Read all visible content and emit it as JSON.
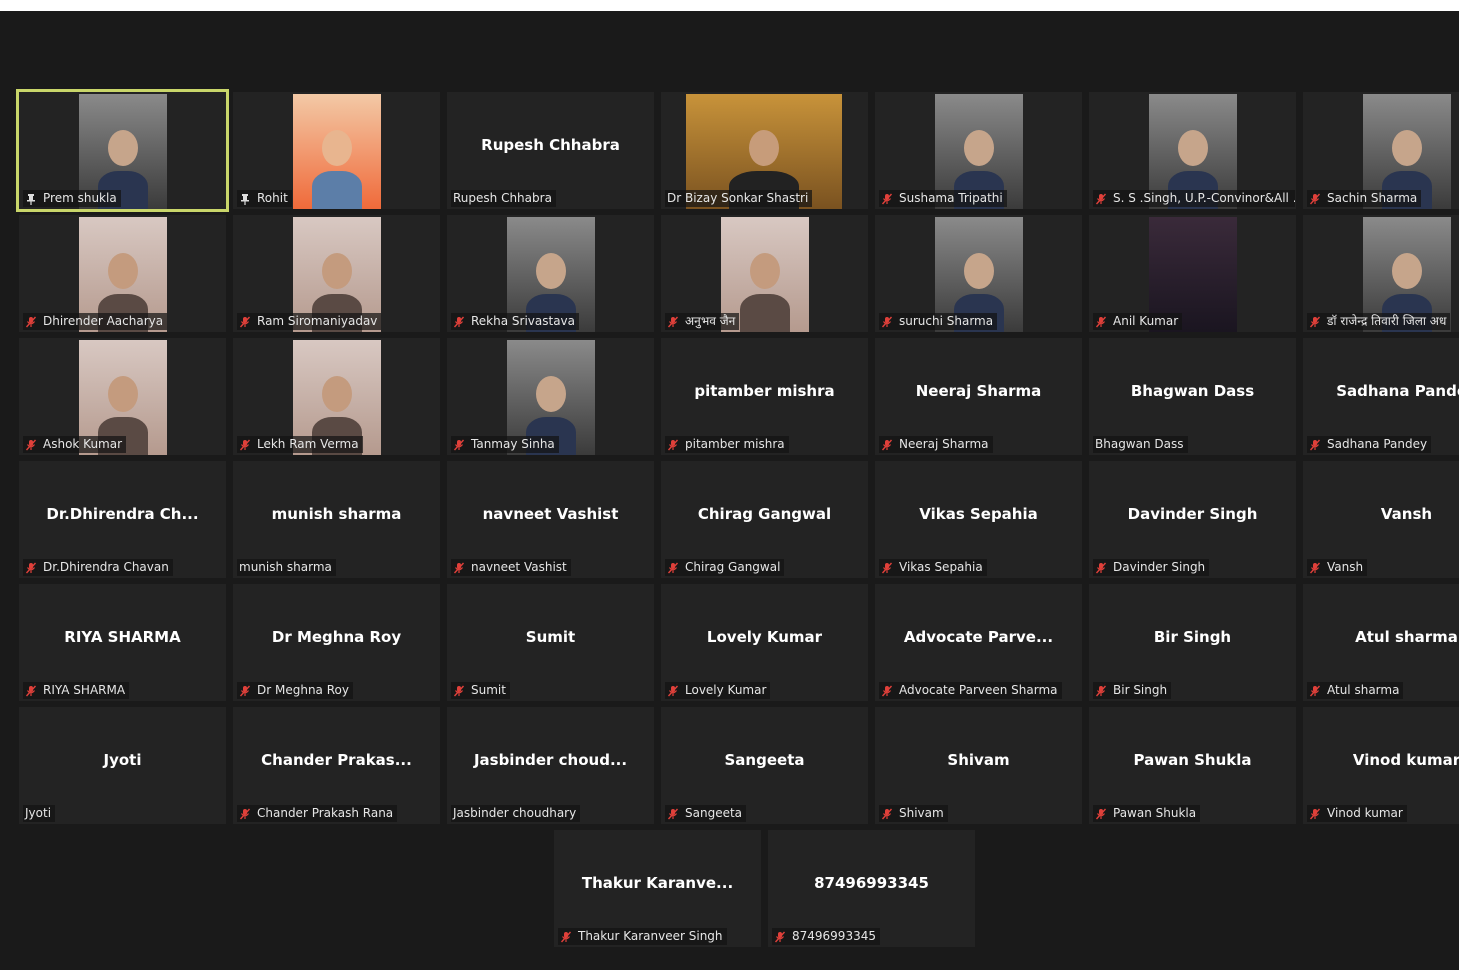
{
  "colors": {
    "background": "#1a1a1a",
    "tile": "#232323",
    "active_border": "#c9d66a",
    "mute": "#e0403a"
  },
  "participants": [
    {
      "name": "Prem shukla",
      "display": "",
      "icon": "pin-icon",
      "video": "person",
      "active": true
    },
    {
      "name": "Rohit",
      "display": "",
      "icon": "pin-icon",
      "video": "poster"
    },
    {
      "name": "Rupesh Chhabra",
      "display": "Rupesh Chhabra",
      "icon": "none",
      "video": "none"
    },
    {
      "name": "Dr Bizay Sonkar Shastri",
      "display": "",
      "icon": "none",
      "video": "wide"
    },
    {
      "name": "Sushama Tripathi",
      "display": "",
      "icon": "mic-muted-icon",
      "video": "person"
    },
    {
      "name": "S. S .Singh, U.P.-Convinor&All ...",
      "display": "",
      "icon": "mic-muted-icon",
      "video": "person"
    },
    {
      "name": "Sachin Sharma",
      "display": "",
      "icon": "mic-muted-icon",
      "video": "person"
    },
    {
      "name": "Dhirender Aacharya",
      "display": "",
      "icon": "mic-muted-icon",
      "video": "room"
    },
    {
      "name": "Ram Siromaniyadav",
      "display": "",
      "icon": "mic-muted-icon",
      "video": "room"
    },
    {
      "name": "Rekha Srivastava",
      "display": "",
      "icon": "mic-muted-icon",
      "video": "person"
    },
    {
      "name": "अनुभव जैन",
      "display": "",
      "icon": "mic-muted-icon",
      "video": "room"
    },
    {
      "name": "suruchi Sharma",
      "display": "",
      "icon": "mic-muted-icon",
      "video": "person"
    },
    {
      "name": "Anil Kumar",
      "display": "",
      "icon": "mic-muted-icon",
      "video": "dark"
    },
    {
      "name": "डॉ राजेन्द्र तिवारी जिला अध",
      "display": "",
      "icon": "mic-muted-icon",
      "video": "person"
    },
    {
      "name": "Ashok Kumar",
      "display": "",
      "icon": "mic-muted-icon",
      "video": "room"
    },
    {
      "name": "Lekh Ram Verma",
      "display": "",
      "icon": "mic-muted-icon",
      "video": "room"
    },
    {
      "name": "Tanmay Sinha",
      "display": "",
      "icon": "mic-muted-icon",
      "video": "person"
    },
    {
      "name": "pitamber mishra",
      "display": "pitamber mishra",
      "icon": "mic-muted-icon",
      "video": "none"
    },
    {
      "name": "Neeraj Sharma",
      "display": "Neeraj Sharma",
      "icon": "mic-muted-icon",
      "video": "none"
    },
    {
      "name": "Bhagwan Dass",
      "display": "Bhagwan Dass",
      "icon": "none",
      "video": "none"
    },
    {
      "name": "Sadhana Pandey",
      "display": "Sadhana Pandey",
      "icon": "mic-muted-icon",
      "video": "none"
    },
    {
      "name": "Dr.Dhirendra Chavan",
      "display": "Dr.Dhirendra  Ch...",
      "icon": "mic-muted-icon",
      "video": "none"
    },
    {
      "name": "munish sharma",
      "display": "munish sharma",
      "icon": "none",
      "video": "none"
    },
    {
      "name": "navneet Vashist",
      "display": "navneet Vashist",
      "icon": "mic-muted-icon",
      "video": "none"
    },
    {
      "name": "Chirag Gangwal",
      "display": "Chirag Gangwal",
      "icon": "mic-muted-icon",
      "video": "none"
    },
    {
      "name": "Vikas Sepahia",
      "display": "Vikas Sepahia",
      "icon": "mic-muted-icon",
      "video": "none"
    },
    {
      "name": "Davinder Singh",
      "display": "Davinder Singh",
      "icon": "mic-muted-icon",
      "video": "none"
    },
    {
      "name": "Vansh",
      "display": "Vansh",
      "icon": "mic-muted-icon",
      "video": "none"
    },
    {
      "name": "RIYA SHARMA",
      "display": "RIYA SHARMA",
      "icon": "mic-muted-icon",
      "video": "none"
    },
    {
      "name": "Dr Meghna Roy",
      "display": "Dr Meghna Roy",
      "icon": "mic-muted-icon",
      "video": "none"
    },
    {
      "name": "Sumit",
      "display": "Sumit",
      "icon": "mic-muted-icon",
      "video": "none"
    },
    {
      "name": "Lovely Kumar",
      "display": "Lovely Kumar",
      "icon": "mic-muted-icon",
      "video": "none"
    },
    {
      "name": "Advocate Parveen Sharma",
      "display": "Advocate  Parve...",
      "icon": "mic-muted-icon",
      "video": "none"
    },
    {
      "name": "Bir Singh",
      "display": "Bir Singh",
      "icon": "mic-muted-icon",
      "video": "none"
    },
    {
      "name": "Atul sharma",
      "display": "Atul sharma",
      "icon": "mic-muted-icon",
      "video": "none"
    },
    {
      "name": "Jyoti",
      "display": "Jyoti",
      "icon": "none",
      "video": "none"
    },
    {
      "name": "Chander Prakash Rana",
      "display": "Chander  Prakas...",
      "icon": "mic-muted-icon",
      "video": "none"
    },
    {
      "name": "Jasbinder choudhary",
      "display": "Jasbinder  choud...",
      "icon": "none",
      "video": "none"
    },
    {
      "name": "Sangeeta",
      "display": "Sangeeta",
      "icon": "mic-muted-icon",
      "video": "none"
    },
    {
      "name": "Shivam",
      "display": "Shivam",
      "icon": "mic-muted-icon",
      "video": "none"
    },
    {
      "name": "Pawan Shukla",
      "display": "Pawan Shukla",
      "icon": "mic-muted-icon",
      "video": "none"
    },
    {
      "name": "Vinod kumar",
      "display": "Vinod kumar",
      "icon": "mic-muted-icon",
      "video": "none"
    },
    {
      "name": "Thakur Karanveer Singh",
      "display": "Thakur  Karanve...",
      "icon": "mic-muted-icon",
      "video": "none"
    },
    {
      "name": "87496993345",
      "display": "87496993345",
      "icon": "mic-muted-icon",
      "video": "none"
    }
  ]
}
